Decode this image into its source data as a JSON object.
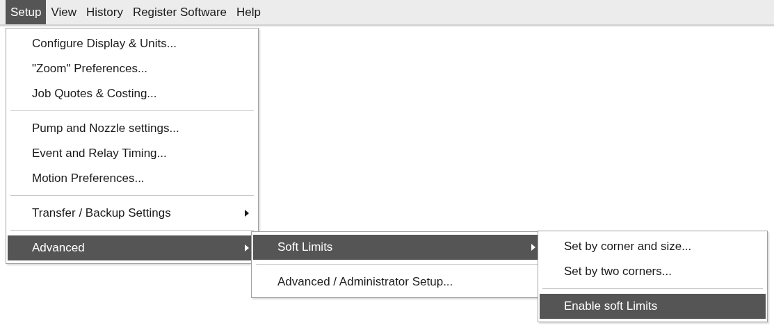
{
  "menubar": [
    {
      "label": "Setup",
      "selected": true
    },
    {
      "label": "View",
      "selected": false
    },
    {
      "label": "History",
      "selected": false
    },
    {
      "label": "Register Software",
      "selected": false
    },
    {
      "label": "Help",
      "selected": false
    }
  ],
  "menu": [
    {
      "kind": "item",
      "label": "Configure Display & Units...",
      "submenu": false,
      "selected": false
    },
    {
      "kind": "item",
      "label": "\"Zoom\" Preferences...",
      "submenu": false,
      "selected": false
    },
    {
      "kind": "item",
      "label": "Job Quotes & Costing...",
      "submenu": false,
      "selected": false
    },
    {
      "kind": "separator"
    },
    {
      "kind": "item",
      "label": "Pump and Nozzle settings...",
      "submenu": false,
      "selected": false
    },
    {
      "kind": "item",
      "label": "Event and Relay Timing...",
      "submenu": false,
      "selected": false
    },
    {
      "kind": "item",
      "label": "Motion Preferences...",
      "submenu": false,
      "selected": false
    },
    {
      "kind": "separator"
    },
    {
      "kind": "item",
      "label": "Transfer / Backup Settings",
      "submenu": true,
      "selected": false
    },
    {
      "kind": "separator"
    },
    {
      "kind": "item",
      "label": "Advanced",
      "submenu": true,
      "selected": true,
      "children": [
        {
          "kind": "item",
          "label": "Soft Limits",
          "submenu": true,
          "selected": true,
          "children": [
            {
              "kind": "item",
              "label": "Set by corner and size...",
              "submenu": false,
              "selected": false
            },
            {
              "kind": "item",
              "label": "Set by two corners...",
              "submenu": false,
              "selected": false
            },
            {
              "kind": "separator"
            },
            {
              "kind": "item",
              "label": "Enable soft Limits",
              "submenu": false,
              "selected": true
            }
          ]
        },
        {
          "kind": "separator"
        },
        {
          "kind": "item",
          "label": "Advanced / Administrator Setup...",
          "submenu": false,
          "selected": false
        }
      ]
    }
  ]
}
